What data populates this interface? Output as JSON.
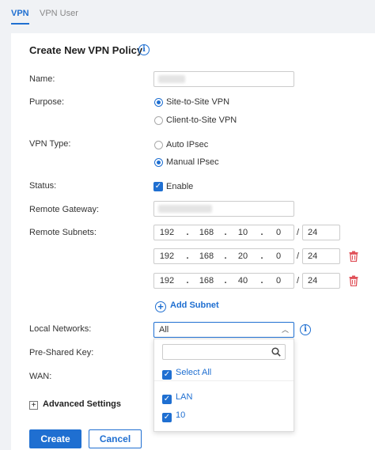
{
  "tabs": [
    {
      "label": "VPN",
      "active": true
    },
    {
      "label": "VPN User",
      "active": false
    }
  ],
  "title": "Create New VPN Policy",
  "fields": {
    "name_label": "Name:",
    "name_value": "",
    "purpose_label": "Purpose:",
    "purpose_options": [
      "Site-to-Site VPN",
      "Client-to-Site VPN"
    ],
    "purpose_selected": "Site-to-Site VPN",
    "vpn_type_label": "VPN Type:",
    "vpn_type_options": [
      "Auto IPsec",
      "Manual IPsec"
    ],
    "vpn_type_selected": "Manual IPsec",
    "status_label": "Status:",
    "status_option": "Enable",
    "remote_gateway_label": "Remote Gateway:",
    "remote_gateway_value": "",
    "remote_subnets_label": "Remote Subnets:",
    "remote_subnets": [
      {
        "o1": "192",
        "o2": "168",
        "o3": "10",
        "o4": "0",
        "mask": "24"
      },
      {
        "o1": "192",
        "o2": "168",
        "o3": "20",
        "o4": "0",
        "mask": "24"
      },
      {
        "o1": "192",
        "o2": "168",
        "o3": "40",
        "o4": "0",
        "mask": "24"
      }
    ],
    "add_subnet_label": "Add Subnet",
    "local_networks_label": "Local Networks:",
    "local_networks_value": "All",
    "pre_shared_key_label": "Pre-Shared Key:",
    "wan_label": "WAN:"
  },
  "dropdown": {
    "search_placeholder": "",
    "select_all": "Select All",
    "items": [
      "LAN",
      "10"
    ]
  },
  "advanced_label": "Advanced Settings",
  "buttons": {
    "create": "Create",
    "cancel": "Cancel"
  },
  "colors": {
    "accent": "#1f6fd1",
    "danger": "#e0525a"
  }
}
